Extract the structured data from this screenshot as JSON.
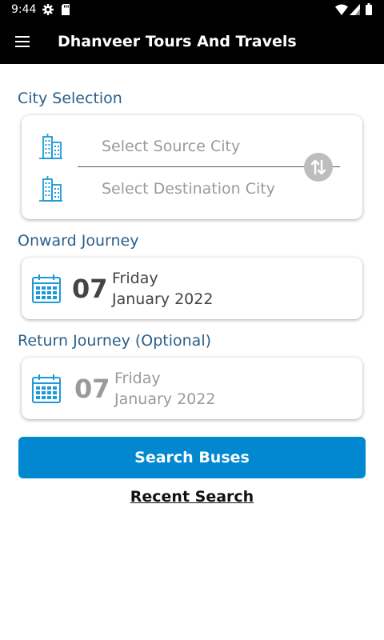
{
  "status_bar": {
    "time": "9:44",
    "icons": [
      "gear-icon",
      "sd-card-icon",
      "wifi-icon",
      "signal-icon",
      "battery-icon"
    ]
  },
  "app_bar": {
    "title": "Dhanveer Tours And Travels",
    "menu_icon": "hamburger-menu-icon"
  },
  "city_selection": {
    "label": "City Selection",
    "source_placeholder": "Select Source City",
    "destination_placeholder": "Select Destination City",
    "city_icon": "city-buildings-icon",
    "swap_icon": "swap-arrows-icon"
  },
  "onward_journey": {
    "label": "Onward Journey",
    "day": "07",
    "weekday": "Friday",
    "month_year": "January 2022"
  },
  "return_journey": {
    "label": "Return Journey (Optional)",
    "day": "07",
    "weekday": "Friday",
    "month_year": "January 2022"
  },
  "actions": {
    "search_label": "Search Buses",
    "recent_label": "Recent Search"
  },
  "colors": {
    "accent": "#0288d1",
    "section_label": "#2a5f8a",
    "icon_blue": "#1e9ad6",
    "app_bar": "#000000"
  }
}
